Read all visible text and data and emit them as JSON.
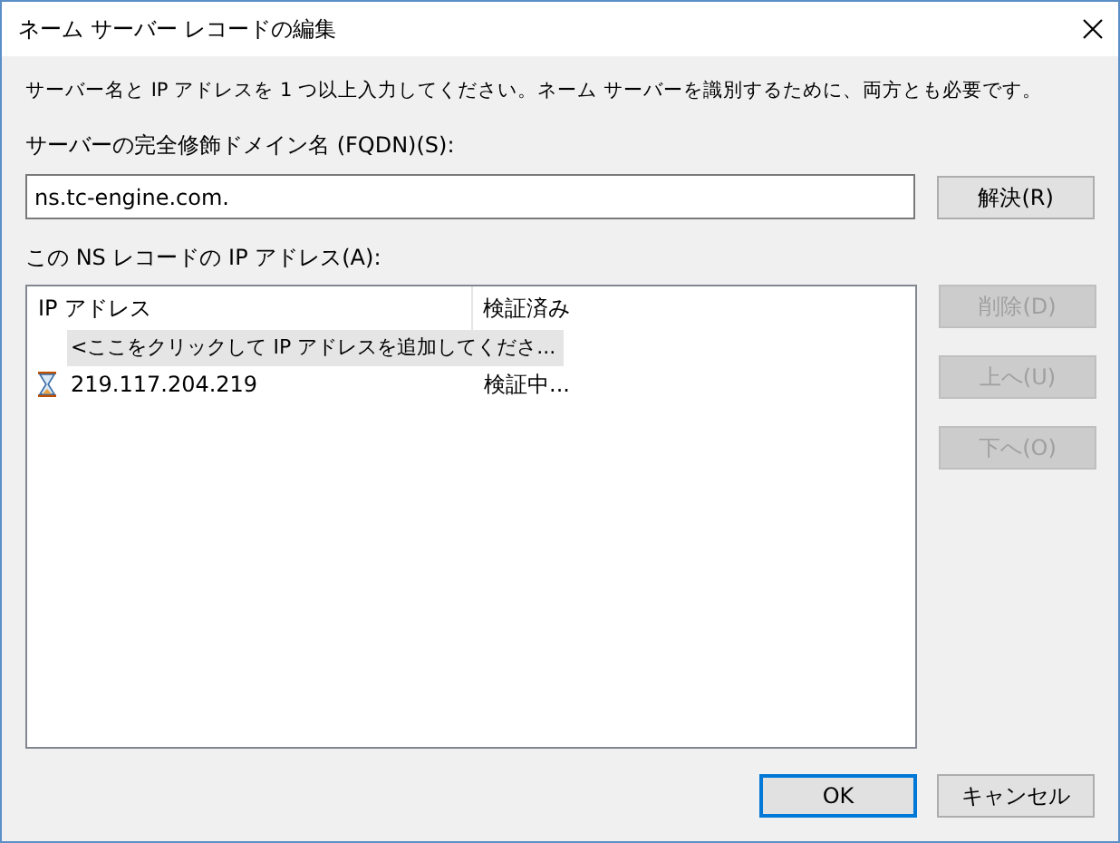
{
  "window": {
    "title": "ネーム サーバー レコードの編集"
  },
  "instruction": "サーバー名と IP アドレスを 1 つ以上入力してください。ネーム サーバーを識別するために、両方とも必要です。",
  "fqdn": {
    "label": "サーバーの完全修飾ドメイン名 (FQDN)(S):",
    "value": "ns.tc-engine.com.",
    "button": {
      "label": "解決(R)",
      "disabled": false
    }
  },
  "ip_list": {
    "label": "この NS レコードの IP アドレス(A):",
    "columns": [
      "IP アドレス",
      "検証済み"
    ],
    "rows": [
      {
        "kind": "add",
        "selected": true,
        "cells": [
          "<ここをクリックして IP アドレスを追加してくださ..."
        ]
      },
      {
        "kind": "pending",
        "selected": false,
        "cells": [
          "219.117.204.219",
          "検証中..."
        ]
      }
    ]
  },
  "side_buttons": [
    {
      "label": "削除(D)",
      "disabled": true
    },
    {
      "label": "上へ(U)",
      "disabled": true
    },
    {
      "label": "下へ(O)",
      "disabled": true
    }
  ],
  "buttons": [
    {
      "label": "OK",
      "default": true
    },
    {
      "label": "キャンセル",
      "default": false
    }
  ]
}
